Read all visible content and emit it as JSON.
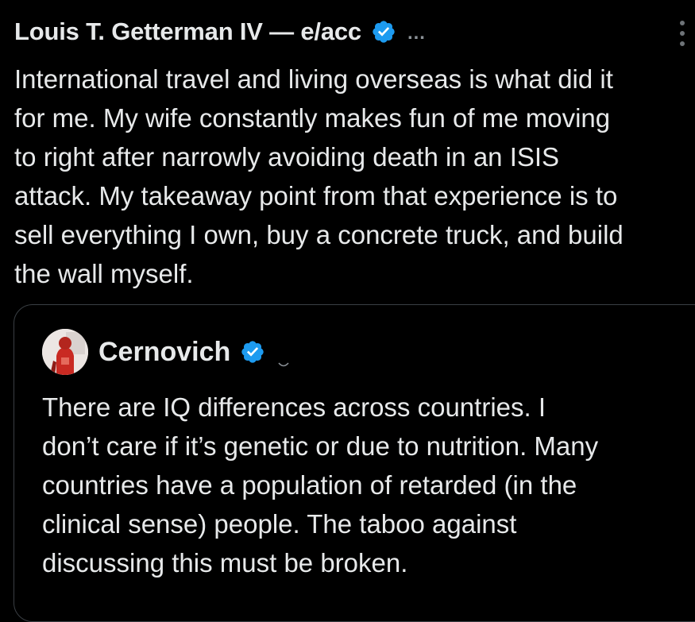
{
  "tweet": {
    "author_name": "Louis T. Getterman IV — e/acc",
    "more_label": "...",
    "text_lines": [
      "International travel and living overseas is what did it",
      "for me. My wife constantly makes fun of me moving",
      "to right after narrowly avoiding death in an ISIS",
      "attack. My takeaway point from that experience is to",
      "sell everything I own, buy a concrete truck, and build",
      "the wall myself."
    ]
  },
  "quoted_tweet": {
    "author_name": "Cernovich",
    "text_lines": [
      "There are IQ differences across countries. I",
      "don’t care if it’s genetic or due to nutrition. Many",
      "countries have a population of retarded (in the",
      "clinical sense) people. The taboo against",
      "discussing this must be broken."
    ]
  },
  "colors": {
    "background": "#000000",
    "text": "#e7e9ea",
    "verified_badge": "#1d9bf0",
    "card_border": "#3a3f44",
    "muted": "#8b9197"
  },
  "icons": {
    "verified": "verified-badge-icon",
    "more": "more-options-icon",
    "kebab": "vertical-dots-icon"
  }
}
